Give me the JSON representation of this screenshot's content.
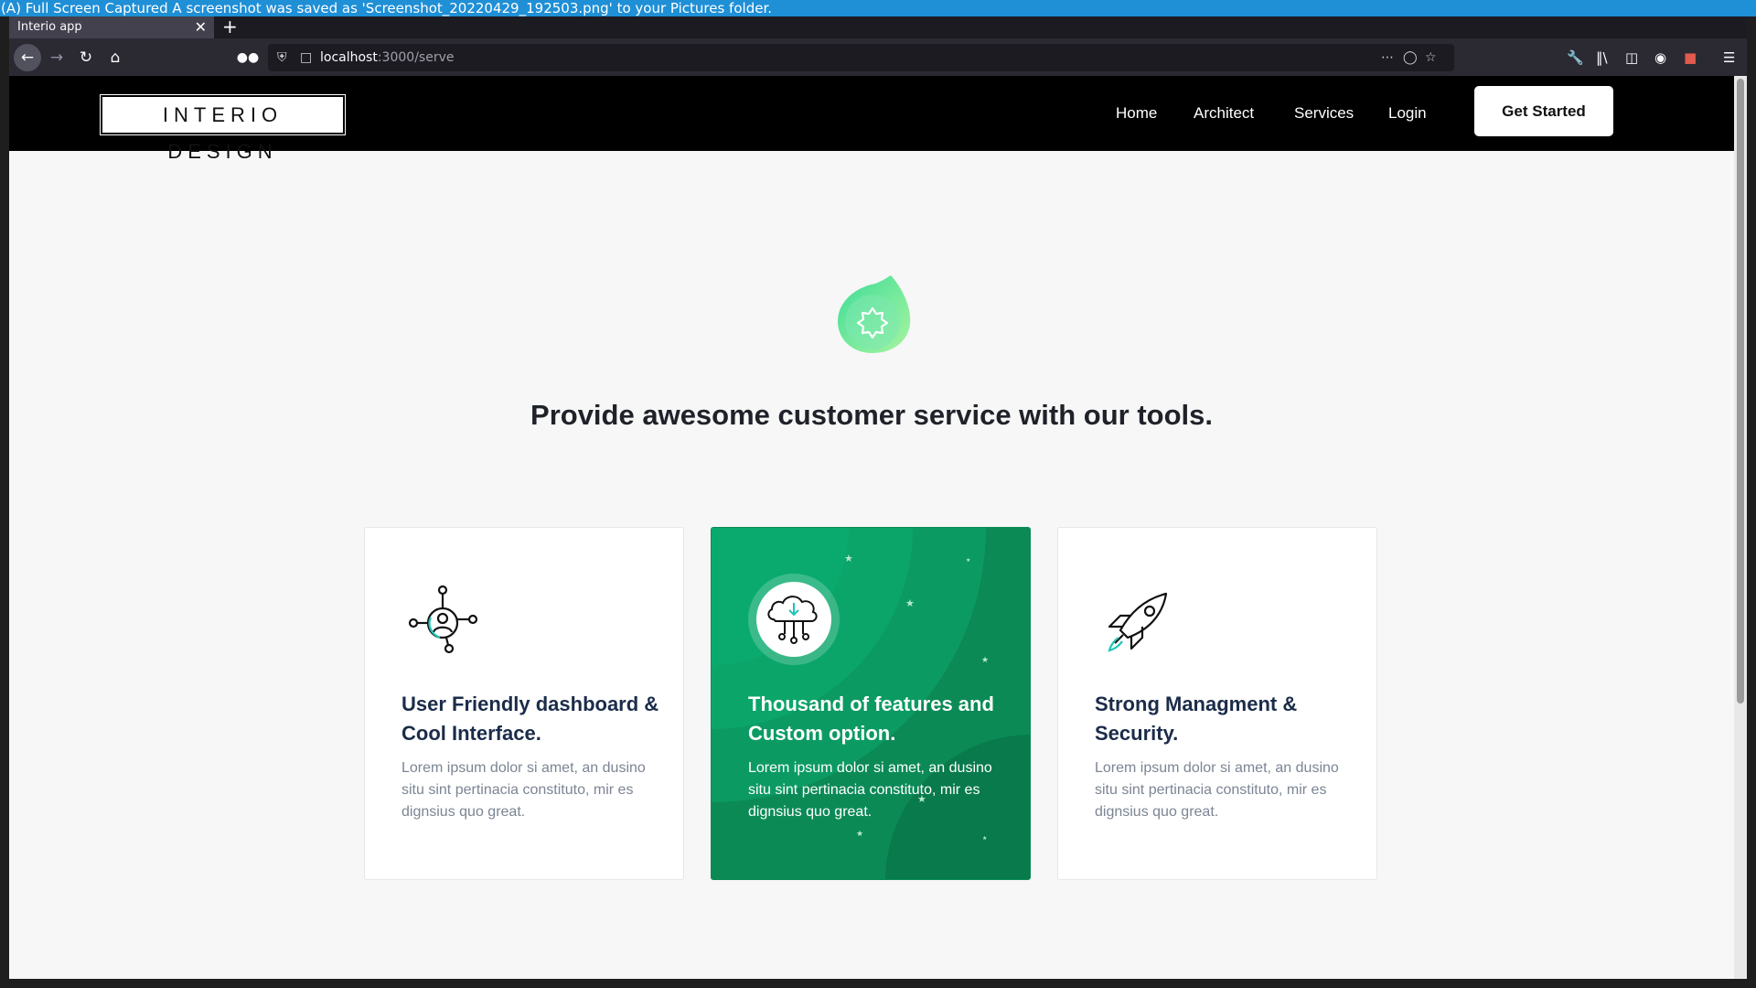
{
  "system": {
    "notification": "(A) Full Screen Captured A screenshot was saved as 'Screenshot_20220429_192503.png' to your Pictures folder."
  },
  "browser": {
    "tab_title": "Interio app",
    "tab_close": "✕",
    "new_tab": "+",
    "url_host": "localhost",
    "url_path": ":3000/serve",
    "icons": [
      "back-icon",
      "forward-icon",
      "reload-icon",
      "home-icon",
      "tracking-icon",
      "shield-icon",
      "page-icon",
      "more-icon",
      "pocket-icon",
      "bookmark-star-icon",
      "wrench-icon",
      "library-icon",
      "sidebar-icon",
      "account-icon",
      "extension-icon",
      "menu-icon"
    ]
  },
  "site": {
    "logo": "INTERIO DESIGN",
    "nav": [
      "Home",
      "Architect",
      "Services",
      "Login"
    ],
    "cta": "Get Started"
  },
  "hero": {
    "title": "Provide awesome customer service with our tools.",
    "icon": "gear-drop-icon"
  },
  "cards": [
    {
      "title": "User Friendly dashboard & Cool Interface.",
      "text": "Lorem ipsum dolor si amet, an dusino situ sint pertinacia constituto, mir es dignsius quo great.",
      "icon": "user-network-icon"
    },
    {
      "title": "Thousand of features and Custom option.",
      "text": "Lorem ipsum dolor si amet, an dusino situ sint pertinacia constituto, mir es dignsius quo great.",
      "icon": "cloud-download-icon"
    },
    {
      "title": "Strong Managment & Security.",
      "text": "Lorem ipsum dolor si amet, an dusino situ sint pertinacia constituto, mir es dignsius quo great.",
      "icon": "rocket-icon"
    }
  ],
  "colors": {
    "accent_green": "#0b8a56",
    "header_bg": "#000000",
    "page_bg": "#f7f7f7",
    "notify_bg": "#1f8fd6"
  }
}
